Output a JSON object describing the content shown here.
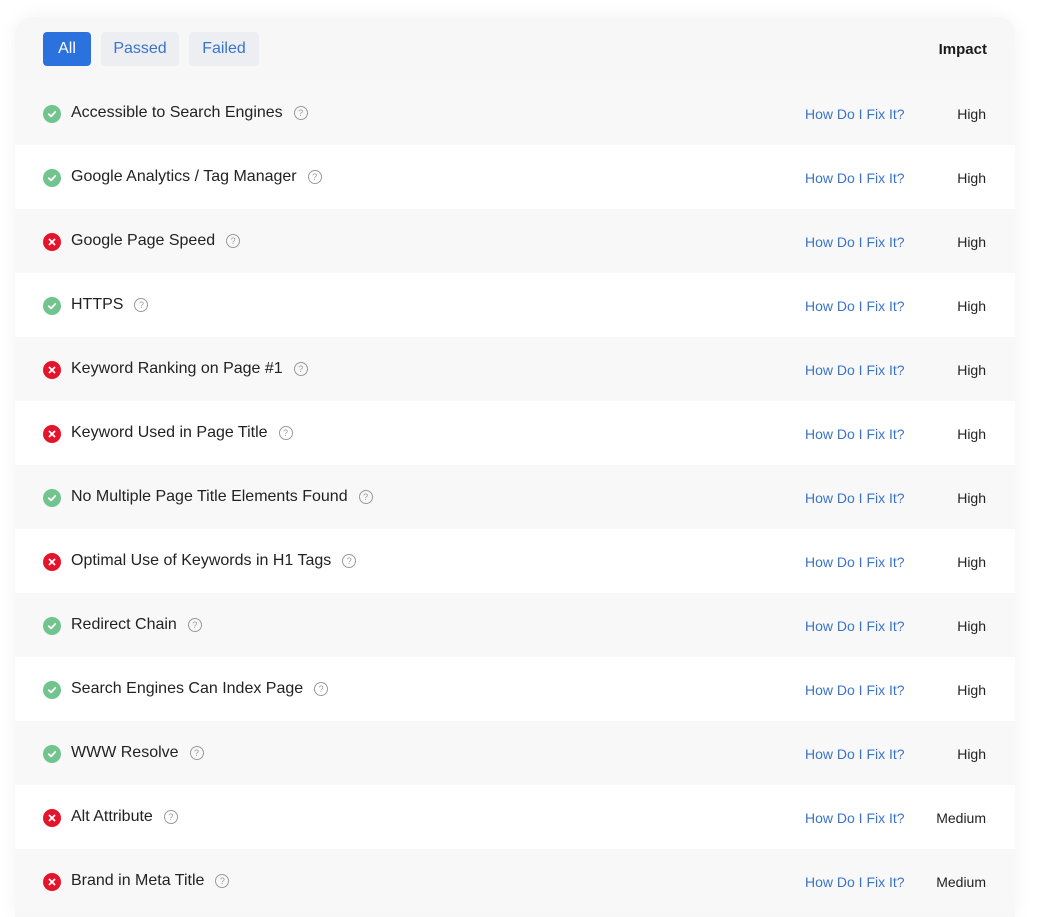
{
  "filters": {
    "all_label": "All",
    "passed_label": "Passed",
    "failed_label": "Failed",
    "active": "All"
  },
  "table": {
    "impact_header": "Impact",
    "fix_link_label": "How Do I Fix It?",
    "rows": [
      {
        "name": "Accessible to Search Engines",
        "status": "passed",
        "impact": "High"
      },
      {
        "name": "Google Analytics / Tag Manager",
        "status": "passed",
        "impact": "High"
      },
      {
        "name": "Google Page Speed",
        "status": "failed",
        "impact": "High"
      },
      {
        "name": "HTTPS",
        "status": "passed",
        "impact": "High"
      },
      {
        "name": "Keyword Ranking on Page #1",
        "status": "failed",
        "impact": "High"
      },
      {
        "name": "Keyword Used in Page Title",
        "status": "failed",
        "impact": "High"
      },
      {
        "name": "No Multiple Page Title Elements Found",
        "status": "passed",
        "impact": "High"
      },
      {
        "name": "Optimal Use of Keywords in H1 Tags",
        "status": "failed",
        "impact": "High"
      },
      {
        "name": "Redirect Chain",
        "status": "passed",
        "impact": "High"
      },
      {
        "name": "Search Engines Can Index Page",
        "status": "passed",
        "impact": "High"
      },
      {
        "name": "WWW Resolve",
        "status": "passed",
        "impact": "High"
      },
      {
        "name": "Alt Attribute",
        "status": "failed",
        "impact": "Medium"
      },
      {
        "name": "Brand in Meta Title",
        "status": "failed",
        "impact": "Medium"
      }
    ]
  },
  "colors": {
    "accent": "#2c72de",
    "link": "#3a74c9",
    "pass": "#72c48d",
    "fail": "#e3142c"
  },
  "icons": {
    "pass": "check-circle-icon",
    "fail": "x-circle-icon",
    "help": "question-circle-icon"
  }
}
